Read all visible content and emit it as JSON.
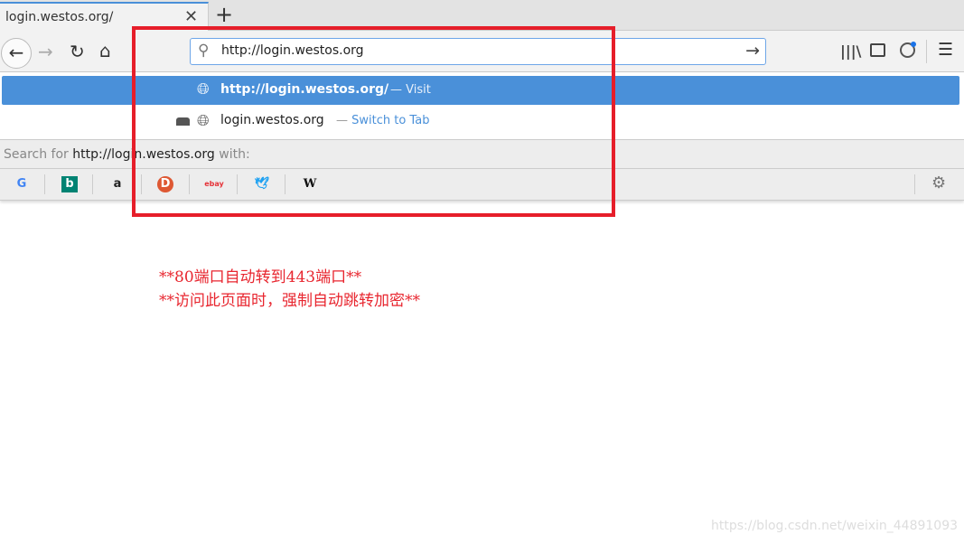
{
  "tab": {
    "title": "login.westos.org/"
  },
  "urlbar": {
    "value": "http://login.westos.org"
  },
  "suggestions": [
    {
      "url": "http://login.westos.org/",
      "action": "Visit",
      "selected": true
    },
    {
      "url": "login.westos.org",
      "action": "Switch to Tab",
      "selected": false
    }
  ],
  "search": {
    "prefix": "Search for ",
    "query": "http://login.westos.org",
    "suffix": " with:"
  },
  "engines": [
    "Google",
    "Bing",
    "Amazon",
    "DuckDuckGo",
    "eBay",
    "Twitter",
    "Wikipedia"
  ],
  "annotations": [
    "**80端口自动转到443端口**",
    "**访问此页面时，强制自动跳转加密**"
  ],
  "watermark": "https://blog.csdn.net/weixin_44891093",
  "colors": {
    "accent": "#4a90d9",
    "annotation": "#e61e2a"
  }
}
